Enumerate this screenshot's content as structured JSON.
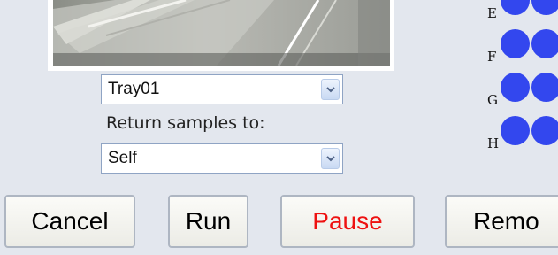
{
  "tray_select": {
    "value": "Tray01"
  },
  "return_select": {
    "label": "Return samples to:",
    "value": "Self"
  },
  "plate": {
    "rows": [
      {
        "label": "E",
        "wells": 2
      },
      {
        "label": "F",
        "wells": 2
      },
      {
        "label": "G",
        "wells": 2
      },
      {
        "label": "H",
        "wells": 2
      }
    ],
    "well_color": "#3347ee"
  },
  "buttons": {
    "cancel": "Cancel",
    "run": "Run",
    "pause": "Pause",
    "remove": "Remo"
  },
  "colors": {
    "background": "#e3e7ee",
    "pause_text": "#ee1111"
  }
}
